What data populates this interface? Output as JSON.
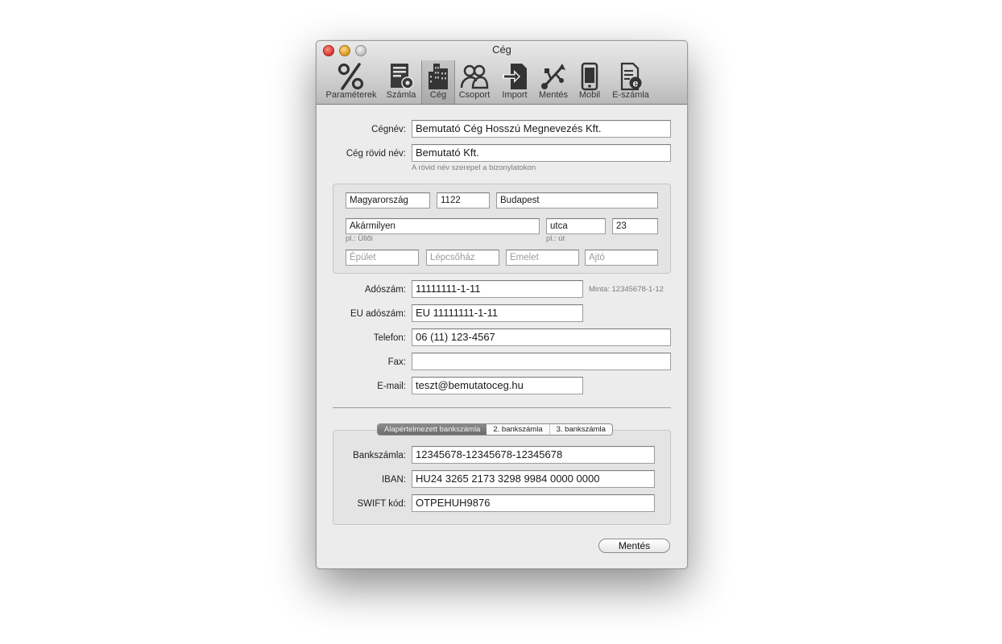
{
  "window": {
    "title": "Cég"
  },
  "toolbar": {
    "items": [
      {
        "label": "Paraméterek",
        "icon": "percent-icon"
      },
      {
        "label": "Számla",
        "icon": "invoice-settings-icon"
      },
      {
        "label": "Cég",
        "icon": "building-icon",
        "active": true
      },
      {
        "label": "Csoport",
        "icon": "group-icon"
      },
      {
        "label": "Import",
        "icon": "import-icon"
      },
      {
        "label": "Mentés",
        "icon": "usb-icon"
      },
      {
        "label": "Mobil",
        "icon": "mobile-icon"
      },
      {
        "label": "E-számla",
        "icon": "e-invoice-icon"
      }
    ]
  },
  "company": {
    "name_label": "Cégnév:",
    "name_value": "Bemutató Cég Hosszú Megnevezés Kft.",
    "short_name_label": "Cég rövid név:",
    "short_name_value": "Bemutató Kft.",
    "short_name_hint": "A rövid név szerepel a bizonylatokon"
  },
  "address": {
    "country": "Magyarország",
    "zip": "1122",
    "city": "Budapest",
    "street": "Akármilyen",
    "street_hint": "pl.: Üllői",
    "street_type": "utca",
    "street_type_hint": "pl.: út",
    "number": "23",
    "building_placeholder": "Épület",
    "staircase_placeholder": "Lépcsőház",
    "floor_placeholder": "Emelet",
    "door_placeholder": "Ajtó"
  },
  "contact": {
    "tax_label": "Adószám:",
    "tax_value": "11111111-1-11",
    "tax_hint": "Minta: 12345678-1-12",
    "eu_tax_label": "EU adószám:",
    "eu_tax_value": "EU 11111111-1-11",
    "phone_label": "Telefon:",
    "phone_value": "06 (11) 123-4567",
    "fax_label": "Fax:",
    "fax_value": "",
    "email_label": "E-mail:",
    "email_value": "teszt@bemutatoceg.hu"
  },
  "bank": {
    "tabs": [
      "Alapértelmezett bankszámla",
      "2. bankszámla",
      "3. bankszámla"
    ],
    "account_label": "Bankszámla:",
    "account_value": "12345678-12345678-12345678",
    "iban_label": "IBAN:",
    "iban_value": "HU24 3265 2173 3298 9984 0000 0000",
    "swift_label": "SWIFT kód:",
    "swift_value": "OTPEHUH9876"
  },
  "actions": {
    "save_label": "Mentés"
  }
}
